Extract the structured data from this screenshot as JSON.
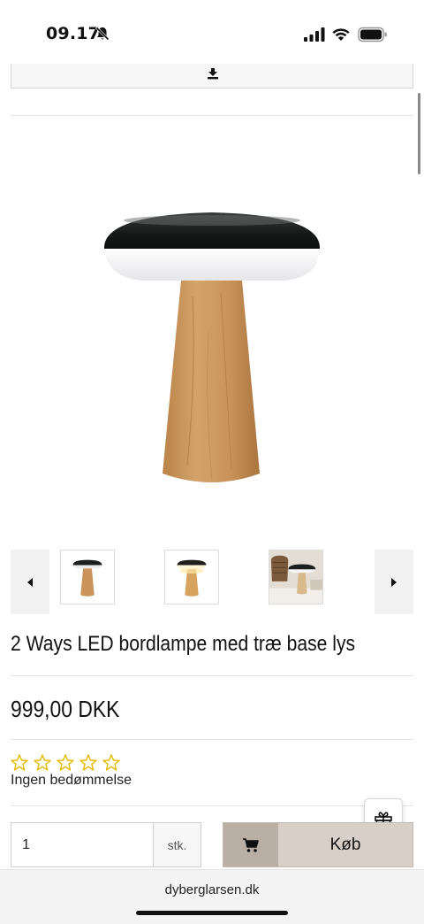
{
  "status_bar": {
    "time": "09.17",
    "icons": [
      "bell-muted-icon",
      "signal-icon",
      "wifi-icon",
      "battery-icon"
    ]
  },
  "download_bar": {
    "icon": "download-icon"
  },
  "product": {
    "title": "2 Ways LED bordlampe med træ base lys",
    "price": "999,00 DKK",
    "rating": {
      "stars_filled": 0,
      "stars_total": 5,
      "text": "Ingen bedømmelse"
    }
  },
  "gallery": {
    "thumbnails": [
      "lamp-dark-shade",
      "lamp-lit",
      "lamp-in-room"
    ]
  },
  "purchase": {
    "quantity": "1",
    "unit": "stk.",
    "buy_label": "Køb"
  },
  "browser": {
    "url": "dyberglarsen.dk"
  },
  "colors": {
    "wood": "#c9955a",
    "shade": "#1c1f1e",
    "buy_bg": "#d8d0c8",
    "star": "#e6b800"
  }
}
